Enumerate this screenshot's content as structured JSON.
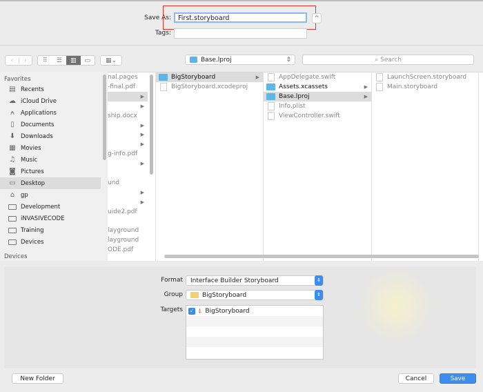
{
  "save": {
    "save_as_label": "Save As:",
    "filename": "First.storyboard",
    "tags_label": "Tags:",
    "tags_value": "",
    "expand_icon": "chevron-up"
  },
  "toolbar": {
    "location": "Base.lproj",
    "search_placeholder": "Search"
  },
  "sidebar": {
    "favorites_label": "Favorites",
    "devices_label": "Devices",
    "items": [
      {
        "label": "Recents",
        "icon": "recents-icon"
      },
      {
        "label": "iCloud Drive",
        "icon": "cloud-icon"
      },
      {
        "label": "Applications",
        "icon": "applications-icon"
      },
      {
        "label": "Documents",
        "icon": "documents-icon"
      },
      {
        "label": "Downloads",
        "icon": "downloads-icon"
      },
      {
        "label": "Movies",
        "icon": "film-icon"
      },
      {
        "label": "Music",
        "icon": "music-icon"
      },
      {
        "label": "Pictures",
        "icon": "camera-icon"
      },
      {
        "label": "Desktop",
        "icon": "desktop-icon",
        "selected": true
      },
      {
        "label": "gp",
        "icon": "home-icon"
      },
      {
        "label": "Development",
        "icon": "folder-icon"
      },
      {
        "label": "iNVASIVECODE",
        "icon": "folder-icon"
      },
      {
        "label": "Training",
        "icon": "folder-icon"
      },
      {
        "label": "Devices",
        "icon": "folder-icon"
      }
    ]
  },
  "columns": {
    "col1": [
      "nal.pages",
      "-final.pdf",
      "",
      "",
      "ship.docx",
      "",
      "",
      "",
      "g-info.pdf",
      "",
      "",
      "und",
      "",
      "",
      "uide2.pdf",
      "",
      "layground",
      "layground",
      "ODE.pdf"
    ],
    "col2": [
      "BigStoryboard",
      "BigStoryboard.xcodeproj"
    ],
    "col3": [
      "AppDelegate.swift",
      "Assets.xcassets",
      "Base.lproj",
      "Info.plist",
      "ViewController.swift"
    ],
    "col4": [
      "LaunchScreen.storyboard",
      "Main.storyboard"
    ]
  },
  "options": {
    "format_label": "Format",
    "format_value": "Interface Builder Storyboard",
    "group_label": "Group",
    "group_value": "BigStoryboard",
    "targets_label": "Targets",
    "targets": [
      {
        "name": "BigStoryboard",
        "checked": true
      }
    ]
  },
  "buttons": {
    "new_folder": "New Folder",
    "cancel": "Cancel",
    "save": "Save"
  },
  "colors": {
    "accent": "#3b8ef0",
    "highlight": "#e8322a",
    "folder": "#5fb5e8"
  }
}
